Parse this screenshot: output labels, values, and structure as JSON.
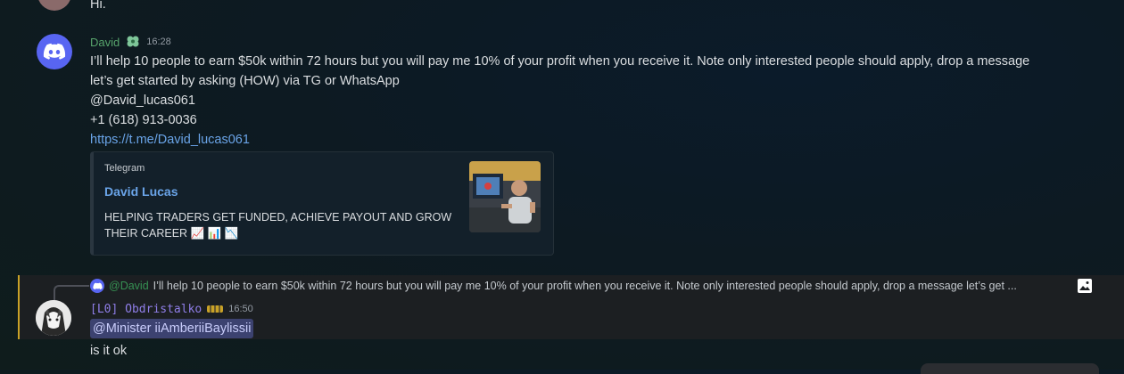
{
  "prev_message": {
    "text": "Hi."
  },
  "david_message": {
    "author": "David",
    "timestamp": "16:28",
    "lines": [
      "I’ll help 10 people to earn $50k within 72 hours but you will pay me 10% of your profit when you receive it. Note only interested people should apply, drop a message",
      "let’s get started by asking (HOW) via TG or WhatsApp",
      "@David_lucas061",
      "+1 (618) 913-0036"
    ],
    "link": "https://t.me/David_lucas061",
    "embed": {
      "provider": "Telegram",
      "title": "David Lucas",
      "description": "HELPING TRADERS GET FUNDED, ACHIEVE PAYOUT AND GROW THEIR CAREER 📈 📊 📉"
    }
  },
  "reply_message": {
    "reply_to": {
      "mention": "@David",
      "snippet": "I’ll help 10 people to earn $50k within 72 hours but you will pay me 10% of your profit when you receive it. Note only interested people should apply, drop a message let’s get ..."
    },
    "author": "[L0] Obdristalko",
    "timestamp": "16:50",
    "mention_pill": "@Minister iiAmberiiBaylissii",
    "text": "is it ok"
  },
  "colors": {
    "discord_blurple": "#5865f2",
    "david_name": "#57a36b",
    "link": "#6aa4e8",
    "reply_highlight_bar": "#c9a227",
    "user_name": "#8f7ee8"
  }
}
